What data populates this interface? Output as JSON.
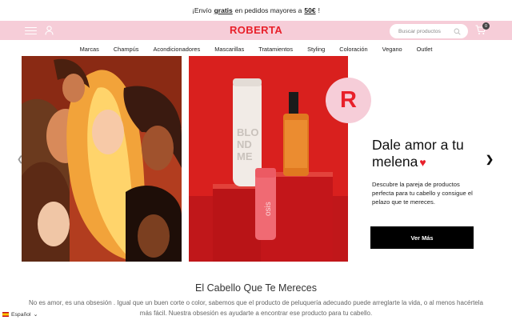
{
  "promo": {
    "prefix": "¡Envío",
    "highlight": "gratis",
    "middle": "en pedidos mayores a",
    "amount": "50€",
    "suffix": "!"
  },
  "header": {
    "logo": "ROBERTA",
    "search_placeholder": "Buscar productos",
    "cart_count": "0",
    "icons": [
      "hamburger-icon",
      "user-icon",
      "search-icon",
      "cart-icon"
    ]
  },
  "nav": {
    "items": [
      "Marcas",
      "Champús",
      "Acondicionadores",
      "Mascarillas",
      "Tratamientos",
      "Styling",
      "Coloración",
      "Vegano",
      "Outlet"
    ]
  },
  "hero": {
    "badge_letter": "R",
    "headline": "Dale amor a tu melena",
    "description": "Descubre la pareja de productos perfecta para tu cabello y consigue el pelazo que te mereces.",
    "cta": "Ver Más",
    "bottle_text_1": "BLOND ME",
    "bottle_text_2": "osis"
  },
  "section": {
    "title": "El Cabello Que Te Mereces",
    "text": "No es amor, es una obsesión . Igual que un buen corte o color, sabemos que el producto de peluquería adecuado puede arreglarte la vida, o al menos hacértela más fácil. Nuestra obsesión es ayudarte a encontrar ese producto para tu cabello."
  },
  "language": {
    "label": "Español"
  },
  "colors": {
    "brand_red": "#e8202a",
    "header_pink": "#f6cdd8",
    "cta_black": "#000000"
  }
}
